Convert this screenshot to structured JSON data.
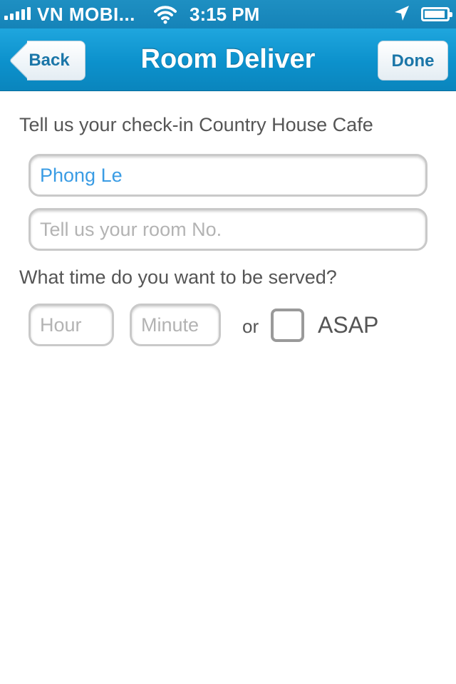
{
  "status_bar": {
    "carrier": "VN MOBI...",
    "time": "3:15 PM",
    "icons": [
      "signal-icon",
      "wifi-icon",
      "location-arrow-icon",
      "battery-icon"
    ]
  },
  "nav": {
    "back_label": "Back",
    "title": "Room Deliver",
    "done_label": "Done"
  },
  "form": {
    "checkin_prompt": "Tell us your check-in Country House Cafe",
    "name_value": "Phong Le",
    "room_placeholder": "Tell us your room No.",
    "time_prompt": "What time do you want to be served?",
    "hour_placeholder": "Hour",
    "minute_placeholder": "Minute",
    "or_label": "or",
    "asap_label": "ASAP",
    "asap_checked": false
  },
  "colors": {
    "nav_bar": "#0c91cc",
    "button_text": "#1b76a8",
    "input_value": "#3a9ce4",
    "placeholder": "#b3b3b3",
    "label_text": "#555555"
  }
}
